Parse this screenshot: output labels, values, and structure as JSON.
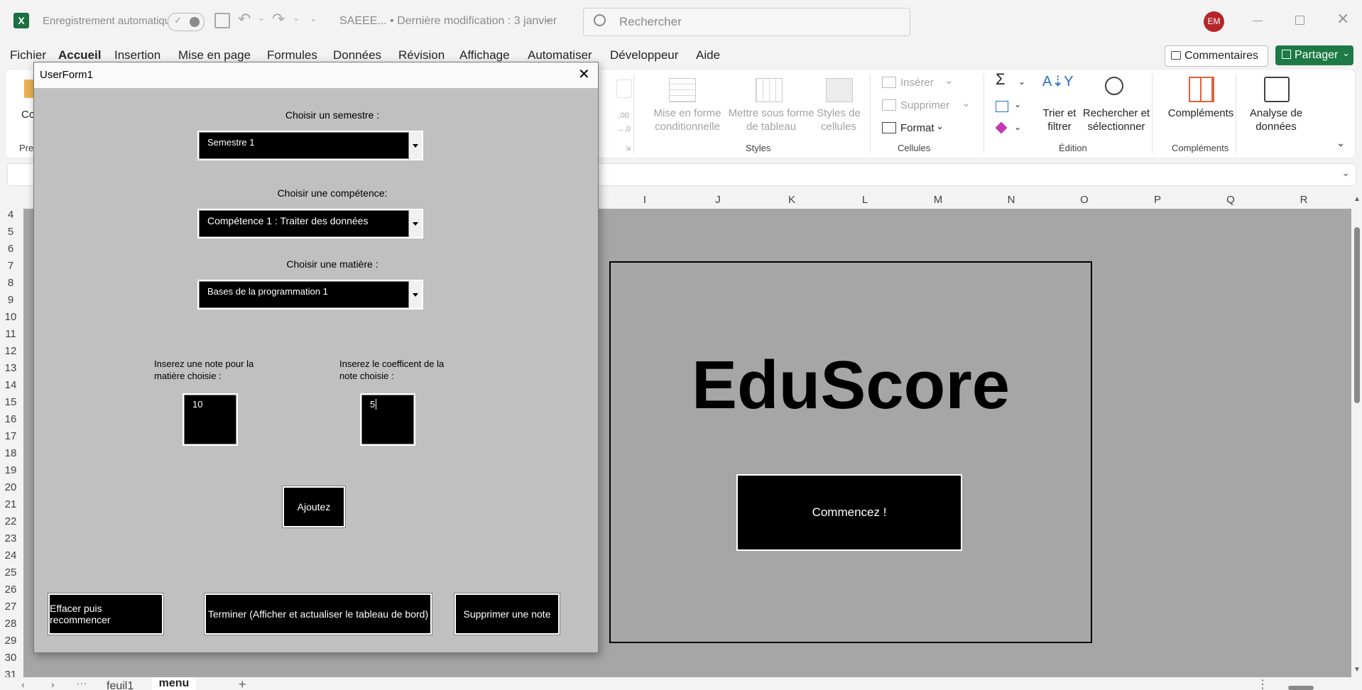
{
  "titlebar": {
    "autosave_label": "Enregistrement automatique",
    "doc_title": "SAEEE... • Dernière modification : 3 janvier",
    "search_placeholder": "Rechercher",
    "avatar_initials": "EM"
  },
  "menu": [
    "Fichier",
    "Accueil",
    "Insertion",
    "Mise en page",
    "Formules",
    "Données",
    "Révision",
    "Affichage",
    "Automatiser",
    "Développeur",
    "Aide"
  ],
  "actions": {
    "comments": "Commentaires",
    "share": "Partager"
  },
  "ribbon": {
    "styles": {
      "conditional_format": "Mise en forme\nconditionnelle",
      "table_format": "Mettre sous forme\nde tableau",
      "cell_styles": "Styles de\ncellules",
      "group": "Styles"
    },
    "cells": {
      "insert": "Insérer",
      "delete": "Supprimer",
      "format": "Format",
      "group": "Cellules"
    },
    "editing": {
      "sort_filter": "Trier et\nfiltrer",
      "find_select": "Rechercher et\nsélectionner",
      "group": "Édition"
    },
    "addins": {
      "addins": "Compléments",
      "group": "Compléments"
    },
    "analysis": {
      "analyze": "Analyse de\ndonnées"
    },
    "clipboard_partial": "Co",
    "group_partial": "Pre"
  },
  "columns": [
    "I",
    "J",
    "K",
    "L",
    "M",
    "N",
    "O",
    "P",
    "Q",
    "R"
  ],
  "rows": [
    "4",
    "5",
    "6",
    "7",
    "8",
    "9",
    "10",
    "11",
    "12",
    "13",
    "14",
    "15",
    "16",
    "17",
    "18",
    "19",
    "20",
    "21",
    "22",
    "23",
    "24",
    "25",
    "26",
    "27",
    "28",
    "29",
    "30",
    "31"
  ],
  "sheet_tabs": {
    "prev": "feuil1",
    "active": "menu"
  },
  "userform": {
    "title": "UserForm1",
    "semester_label": "Choisir un semestre :",
    "semester_value": "Semestre 1",
    "competence_label": "Choisir une compétence:",
    "competence_value": "Compétence 1 : Traiter des données",
    "subject_label": "Choisir une matière :",
    "subject_value": "Bases de la programmation 1",
    "note_label": "Inserez une note  pour la matière choisie :",
    "note_value": "10",
    "coef_label": "Inserez le coefficent de la note choisie :",
    "coef_value": "5",
    "add_button": "Ajoutez",
    "clear_button": "Effacer puis recommencer",
    "finish_button": "Terminer (Afficher et actualiser le tableau de bord)",
    "delete_button": "Supprimer une note"
  },
  "sheet_content": {
    "brand": "EduScore",
    "start_button": "Commencez !"
  }
}
